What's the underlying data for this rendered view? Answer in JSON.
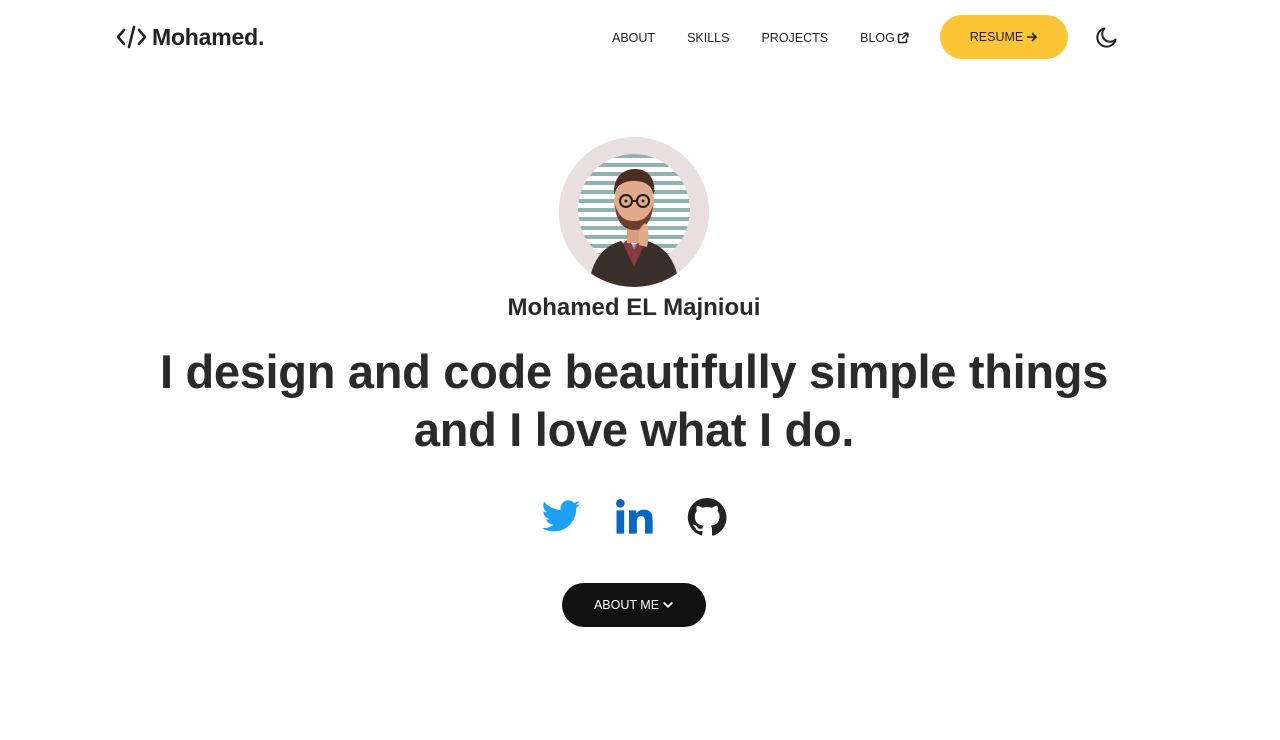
{
  "brand": {
    "name": "Mohamed.",
    "icon": "code-icon"
  },
  "nav": {
    "items": [
      {
        "label": "ABOUT"
      },
      {
        "label": "SKILLS"
      },
      {
        "label": "PROJECTS"
      },
      {
        "label": "BLOG",
        "icon": "external-link-icon"
      }
    ],
    "resume_label": "RESUME",
    "resume_icon": "arrow-right-icon",
    "theme_toggle_icon": "moon-icon"
  },
  "hero": {
    "avatar_alt": "avatar",
    "name": "Mohamed EL Majnioui",
    "tagline_line1": "I design and code beautifully simple things",
    "tagline_line2": "and I love what I do.",
    "socials": [
      {
        "name": "twitter-icon",
        "color": "#1da1f2"
      },
      {
        "name": "linkedin-icon",
        "color": "#0a66c2"
      },
      {
        "name": "github-icon",
        "color": "#222222"
      }
    ],
    "about_label": "ABOUT ME",
    "about_icon": "chevron-down-icon"
  },
  "colors": {
    "accent": "#fcc535",
    "text": "#222222",
    "button_dark": "#111111"
  }
}
